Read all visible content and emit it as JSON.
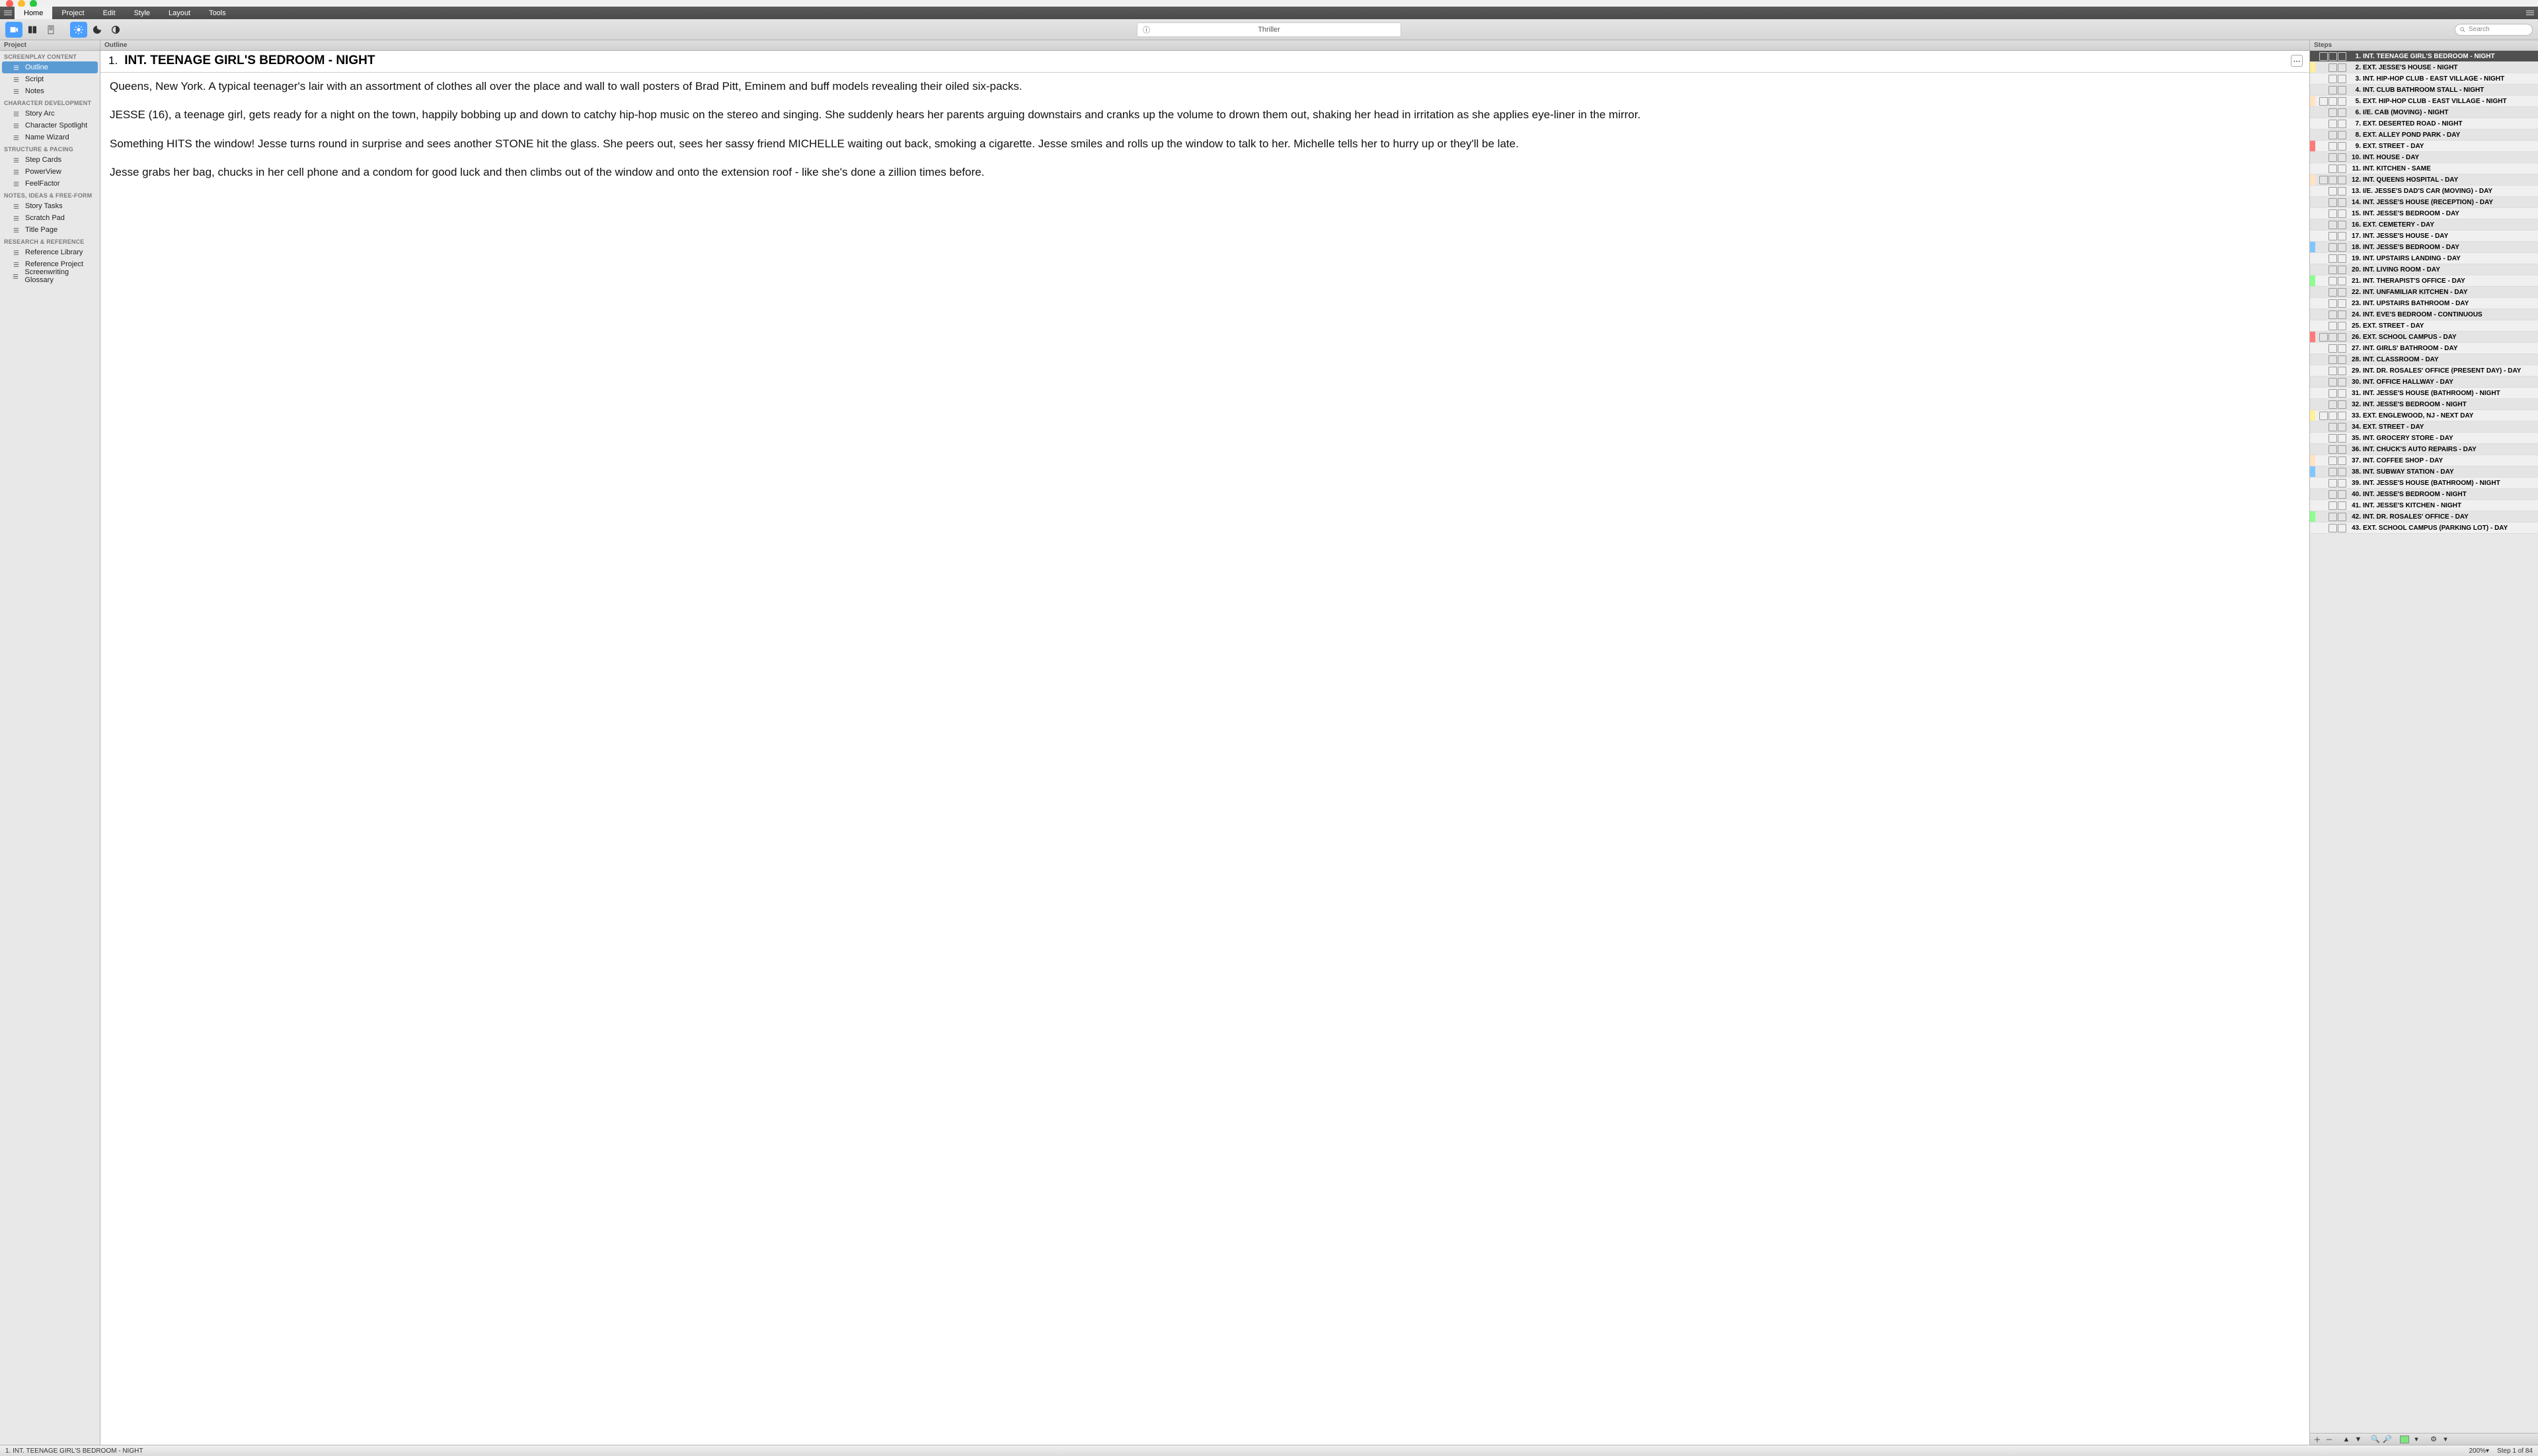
{
  "window": {
    "title": "Thriller"
  },
  "menubar": {
    "items": [
      "Home",
      "Project",
      "Edit",
      "Style",
      "Layout",
      "Tools"
    ],
    "active": 0
  },
  "toolbar": {
    "search_placeholder": "Search"
  },
  "sidebar_left": {
    "header": "Project",
    "sections": [
      {
        "label": "SCREENPLAY CONTENT",
        "items": [
          {
            "label": "Outline",
            "selected": true,
            "icon": "list"
          },
          {
            "label": "Script",
            "icon": "doc"
          },
          {
            "label": "Notes",
            "icon": "note"
          }
        ]
      },
      {
        "label": "CHARACTER DEVELOPMENT",
        "items": [
          {
            "label": "Story Arc",
            "icon": "user"
          },
          {
            "label": "Character Spotlight",
            "icon": "user"
          },
          {
            "label": "Name Wizard",
            "icon": "user"
          }
        ]
      },
      {
        "label": "STRUCTURE & PACING",
        "items": [
          {
            "label": "Step Cards",
            "icon": "grid"
          },
          {
            "label": "PowerView",
            "icon": "waves"
          },
          {
            "label": "FeelFactor",
            "icon": "heart"
          }
        ]
      },
      {
        "label": "NOTES, IDEAS & FREE-FORM",
        "items": [
          {
            "label": "Story Tasks",
            "icon": "check"
          },
          {
            "label": "Scratch Pad",
            "icon": "note"
          },
          {
            "label": "Title Page",
            "icon": "page"
          }
        ]
      },
      {
        "label": "RESEARCH & REFERENCE",
        "items": [
          {
            "label": "Reference Library",
            "icon": "books"
          },
          {
            "label": "Reference Project",
            "icon": "doc"
          },
          {
            "label": "Screenwriting Glossary",
            "icon": "book"
          }
        ]
      }
    ]
  },
  "editor": {
    "header": "Outline",
    "scene_number": "1.",
    "scene_heading": "INT. TEENAGE GIRL'S BEDROOM - NIGHT",
    "paragraphs": [
      "Queens, New York.  A typical teenager's lair with an assortment of clothes all over the place and wall to wall posters of Brad Pitt, Eminem and buff models revealing their oiled six-packs.",
      "JESSE (16), a teenage girl, gets ready for a night on the town, happily bobbing up and down to catchy hip-hop music on the stereo and singing.  She suddenly hears her parents arguing downstairs and cranks up the volume to drown them out, shaking her head in irritation as she applies eye-liner in the mirror.",
      "Something HITS the window!  Jesse turns round in surprise and sees another STONE hit the glass.  She peers out, sees her sassy friend MICHELLE waiting out back, smoking a cigarette.  Jesse smiles and rolls up the window to talk to her.  Michelle tells her to hurry up or they'll be late.",
      "Jesse grabs her bag, chucks in her cell phone and a condom for good luck and then climbs out of the window and onto the extension roof - like she's done a zillion times before."
    ]
  },
  "steps": {
    "header": "Steps",
    "items": [
      {
        "n": 1,
        "title": "INT. TEENAGE GIRL'S BEDROOM - NIGHT",
        "color": "",
        "icons": 3,
        "selected": true
      },
      {
        "n": 2,
        "title": "EXT. JESSE'S HOUSE - NIGHT",
        "color": "#fff09a",
        "icons": 2
      },
      {
        "n": 3,
        "title": "INT. HIP-HOP CLUB - EAST VILLAGE - NIGHT",
        "color": "",
        "icons": 2
      },
      {
        "n": 4,
        "title": "INT. CLUB BATHROOM STALL - NIGHT",
        "color": "",
        "icons": 2
      },
      {
        "n": 5,
        "title": "EXT. HIP-HOP CLUB - EAST VILLAGE - NIGHT",
        "color": "#ffe3c2",
        "icons": 3
      },
      {
        "n": 6,
        "title": "I/E. CAB (MOVING) - NIGHT",
        "color": "",
        "icons": 2
      },
      {
        "n": 7,
        "title": "EXT. DESERTED ROAD - NIGHT",
        "color": "",
        "icons": 2
      },
      {
        "n": 8,
        "title": "EXT. ALLEY POND PARK - DAY",
        "color": "",
        "icons": 2
      },
      {
        "n": 9,
        "title": "EXT. STREET - DAY",
        "color": "#ff7a7a",
        "icons": 2
      },
      {
        "n": 10,
        "title": "INT. HOUSE - DAY",
        "color": "",
        "icons": 2
      },
      {
        "n": 11,
        "title": "INT. KITCHEN - SAME",
        "color": "",
        "icons": 2
      },
      {
        "n": 12,
        "title": "INT. QUEENS HOSPITAL - DAY",
        "color": "#ffe3c2",
        "icons": 3
      },
      {
        "n": 13,
        "title": "I/E.  JESSE'S DAD'S CAR (MOVING) - DAY",
        "color": "",
        "icons": 2
      },
      {
        "n": 14,
        "title": "INT. JESSE'S HOUSE (RECEPTION) - DAY",
        "color": "",
        "icons": 2
      },
      {
        "n": 15,
        "title": "INT. JESSE'S BEDROOM - DAY",
        "color": "",
        "icons": 2
      },
      {
        "n": 16,
        "title": "EXT. CEMETERY - DAY",
        "color": "",
        "icons": 2
      },
      {
        "n": 17,
        "title": "INT. JESSE'S HOUSE - DAY",
        "color": "",
        "icons": 2
      },
      {
        "n": 18,
        "title": "INT. JESSE'S BEDROOM - DAY",
        "color": "#7fc7ff",
        "icons": 2
      },
      {
        "n": 19,
        "title": "INT. UPSTAIRS LANDING - DAY",
        "color": "",
        "icons": 2
      },
      {
        "n": 20,
        "title": "INT. LIVING ROOM - DAY",
        "color": "",
        "icons": 2
      },
      {
        "n": 21,
        "title": "INT. THERAPIST'S OFFICE - DAY",
        "color": "#8cff8c",
        "icons": 2
      },
      {
        "n": 22,
        "title": "INT. UNFAMILIAR KITCHEN - DAY",
        "color": "",
        "icons": 2
      },
      {
        "n": 23,
        "title": "INT. UPSTAIRS BATHROOM - DAY",
        "color": "",
        "icons": 2
      },
      {
        "n": 24,
        "title": "INT. EVE'S BEDROOM - CONTINUOUS",
        "color": "",
        "icons": 2
      },
      {
        "n": 25,
        "title": "EXT. STREET - DAY",
        "color": "",
        "icons": 2
      },
      {
        "n": 26,
        "title": "EXT. SCHOOL CAMPUS - DAY",
        "color": "#ff7a7a",
        "icons": 3
      },
      {
        "n": 27,
        "title": "INT. GIRLS' BATHROOM - DAY",
        "color": "",
        "icons": 2
      },
      {
        "n": 28,
        "title": "INT. CLASSROOM - DAY",
        "color": "",
        "icons": 2
      },
      {
        "n": 29,
        "title": "INT. DR. ROSALES' OFFICE (PRESENT DAY) - DAY",
        "color": "",
        "icons": 2
      },
      {
        "n": 30,
        "title": "INT. OFFICE HALLWAY - DAY",
        "color": "",
        "icons": 2
      },
      {
        "n": 31,
        "title": "INT. JESSE'S HOUSE (BATHROOM) - NIGHT",
        "color": "",
        "icons": 2
      },
      {
        "n": 32,
        "title": "INT. JESSE'S BEDROOM - NIGHT",
        "color": "",
        "icons": 2
      },
      {
        "n": 33,
        "title": "EXT. ENGLEWOOD, NJ - NEXT DAY",
        "color": "#fff09a",
        "icons": 3
      },
      {
        "n": 34,
        "title": "EXT. STREET - DAY",
        "color": "",
        "icons": 2
      },
      {
        "n": 35,
        "title": "INT. GROCERY STORE - DAY",
        "color": "",
        "icons": 2
      },
      {
        "n": 36,
        "title": "INT. CHUCK'S AUTO REPAIRS - DAY",
        "color": "",
        "icons": 2
      },
      {
        "n": 37,
        "title": "INT. COFFEE SHOP - DAY",
        "color": "#ffe3c2",
        "icons": 2
      },
      {
        "n": 38,
        "title": "INT. SUBWAY STATION - DAY",
        "color": "#7fc7ff",
        "icons": 2
      },
      {
        "n": 39,
        "title": "INT. JESSE'S HOUSE (BATHROOM) - NIGHT",
        "color": "",
        "icons": 2
      },
      {
        "n": 40,
        "title": "INT. JESSE'S BEDROOM - NIGHT",
        "color": "",
        "icons": 2
      },
      {
        "n": 41,
        "title": "INT. JESSE'S KITCHEN - NIGHT",
        "color": "",
        "icons": 2
      },
      {
        "n": 42,
        "title": "INT. DR. ROSALES' OFFICE - DAY",
        "color": "#8cff8c",
        "icons": 2
      },
      {
        "n": 43,
        "title": "EXT. SCHOOL CAMPUS (PARKING LOT) - DAY",
        "color": "",
        "icons": 2
      }
    ]
  },
  "statusbar": {
    "left": "1.  INT. TEENAGE GIRL'S BEDROOM - NIGHT",
    "zoom": "200%▾",
    "position": "Step 1 of 84"
  }
}
